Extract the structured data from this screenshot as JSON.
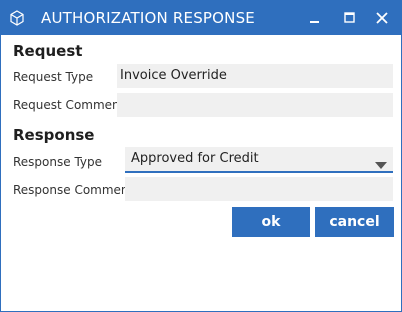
{
  "window": {
    "title": "AUTHORIZATION RESPONSE",
    "icons": {
      "app": "cube-icon",
      "minimize": "minimize-icon",
      "maximize": "maximize-icon",
      "close": "close-icon"
    }
  },
  "request": {
    "heading": "Request",
    "type_label": "Request Type",
    "type_value": "Invoice Override",
    "comment_label": "Request Comment",
    "comment_value": ""
  },
  "response": {
    "heading": "Response",
    "type_label": "Response Type",
    "type_value": "Approved for Credit",
    "comment_label": "Response Comment",
    "comment_value": ""
  },
  "buttons": {
    "ok": "ok",
    "cancel": "cancel"
  },
  "colors": {
    "accent": "#2f6fbe",
    "field_bg": "#f0f0f0"
  }
}
